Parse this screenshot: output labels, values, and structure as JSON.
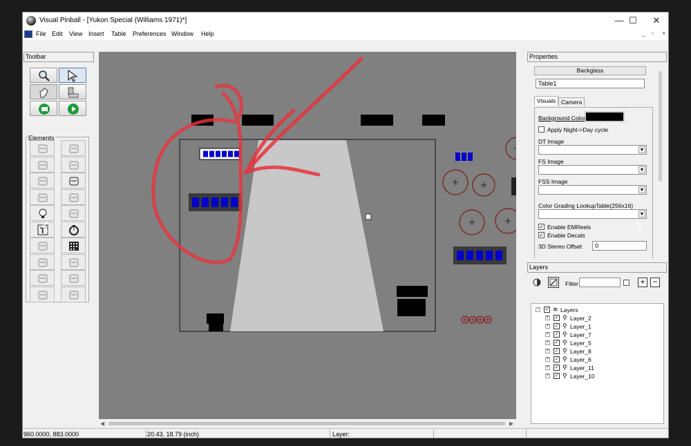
{
  "window": {
    "title": "Visual Pinball - [Yukon Special (Williams 1971)*]",
    "controls": {
      "minimize": "—",
      "maximize": "☐",
      "close": "✕"
    }
  },
  "menu": {
    "items": [
      "File",
      "Edit",
      "View",
      "Insert",
      "Table",
      "Preferences",
      "Window",
      "Help"
    ],
    "mdi_controls": {
      "minimize": "_",
      "restore": "▫",
      "close": "×"
    }
  },
  "toolbar": {
    "title": "Toolbar",
    "buttons": [
      {
        "icon": "magnifier-icon"
      },
      {
        "icon": "arrow-cursor-icon"
      },
      {
        "icon": "hand-icon"
      },
      {
        "icon": "backglass-icon"
      },
      {
        "icon": "camera-record-icon"
      },
      {
        "icon": "play-icon"
      }
    ]
  },
  "elements": {
    "title": "Elements",
    "icons": [
      "wall-icon",
      "gate-icon",
      "ramp-icon",
      "flipper-icon",
      "plunger-icon",
      "bumper-icon",
      "kicker-icon",
      "spinner-icon",
      "light-icon",
      "trigger-icon",
      "textbox-icon",
      "timer-icon",
      "dispreel-icon",
      "lightseq-icon",
      "primitive-icon",
      "flasher-icon",
      "rubber-icon",
      "target-icon",
      "decal-icon",
      "disabled-icon"
    ]
  },
  "properties": {
    "title": "Properties",
    "mode": "Backglass",
    "object_name": "Table1",
    "tabs": [
      "Visuals",
      "Camera"
    ],
    "background_color_label": "Background Color",
    "background_color": "#000000",
    "apply_night_day": "Apply Night->Day cycle",
    "apply_night_day_checked": false,
    "dt_image_label": "DT Image",
    "dt_image": "",
    "fs_image_label": "FS Image",
    "fs_image": "",
    "fss_image_label": "FSS Image",
    "fss_image": "",
    "color_grading_label": "Color Grading LookupTable(256x16)",
    "color_grading": "",
    "enable_emreels": "Enable EMReels",
    "enable_emreels_checked": true,
    "enable_decals": "Enable Decals",
    "enable_decals_checked": true,
    "stereo_offset_label": "3D Stereo Offset",
    "stereo_offset": "0"
  },
  "layers": {
    "title": "Layers",
    "filter_label": "Filter",
    "filter_value": "",
    "root": "Layers",
    "items": [
      "Layer_2",
      "Layer_1",
      "Layer_7",
      "Layer_5",
      "Layer_8",
      "Layer_6",
      "Layer_11",
      "Layer_10"
    ]
  },
  "status": {
    "coords": "960.0000, 883.0000",
    "position": "20.43, 18.79 (inch)",
    "layer": "Layer:"
  },
  "colors": {
    "canvas": "#808080",
    "reel_blue": "#0000cc",
    "annotation": "#e8333d",
    "play_green": "#1e9b3a"
  }
}
